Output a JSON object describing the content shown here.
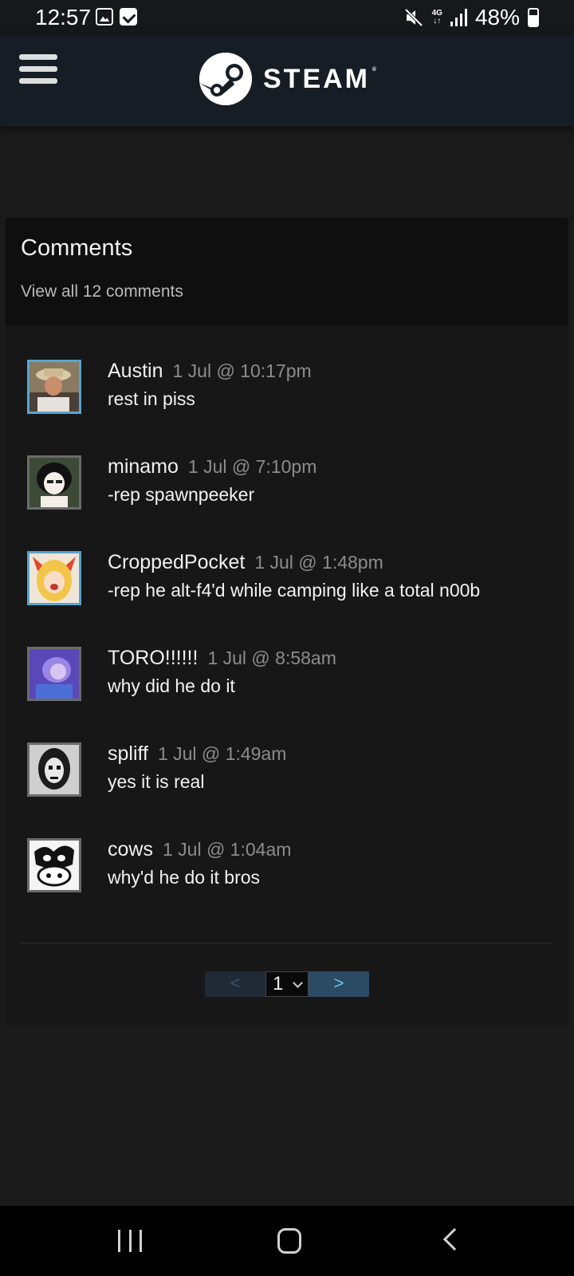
{
  "status_bar": {
    "time": "12:57",
    "network": "4G",
    "battery": "48%",
    "icons": [
      "image-notification-icon",
      "checkbox-notification-icon",
      "mute-icon",
      "4g-icon",
      "signal-icon",
      "battery-icon"
    ]
  },
  "header": {
    "brand": "STEAM",
    "registered": "®",
    "icons": [
      "menu-icon",
      "steam-logo-icon"
    ]
  },
  "comments": {
    "title": "Comments",
    "view_all": "View all 12 comments",
    "items": [
      {
        "author": "Austin",
        "timestamp": "1 Jul @ 10:17pm",
        "text": "rest in piss",
        "online": true
      },
      {
        "author": "minamo",
        "timestamp": "1 Jul @ 7:10pm",
        "text": "-rep spawnpeeker",
        "online": false
      },
      {
        "author": "CroppedPocket",
        "timestamp": "1 Jul @ 1:48pm",
        "text": "-rep he alt-f4'd while camping like a total n00b",
        "online": true
      },
      {
        "author": "TORO!!!!!!",
        "timestamp": "1 Jul @ 8:58am",
        "text": "why did he do it",
        "online": false
      },
      {
        "author": "spliff",
        "timestamp": "1 Jul @ 1:49am",
        "text": "yes it is real",
        "online": false
      },
      {
        "author": "cows",
        "timestamp": "1 Jul @ 1:04am",
        "text": "why'd he do it bros",
        "online": false
      }
    ]
  },
  "pagination": {
    "prev": "<",
    "page": "1",
    "next": ">"
  },
  "colors": {
    "background": "#1b1b1c",
    "header": "#171d25",
    "panel": "#171717",
    "online_border": "#57a5cf",
    "offline_border": "#6b6b6b",
    "next_button": "#2c4a63"
  }
}
